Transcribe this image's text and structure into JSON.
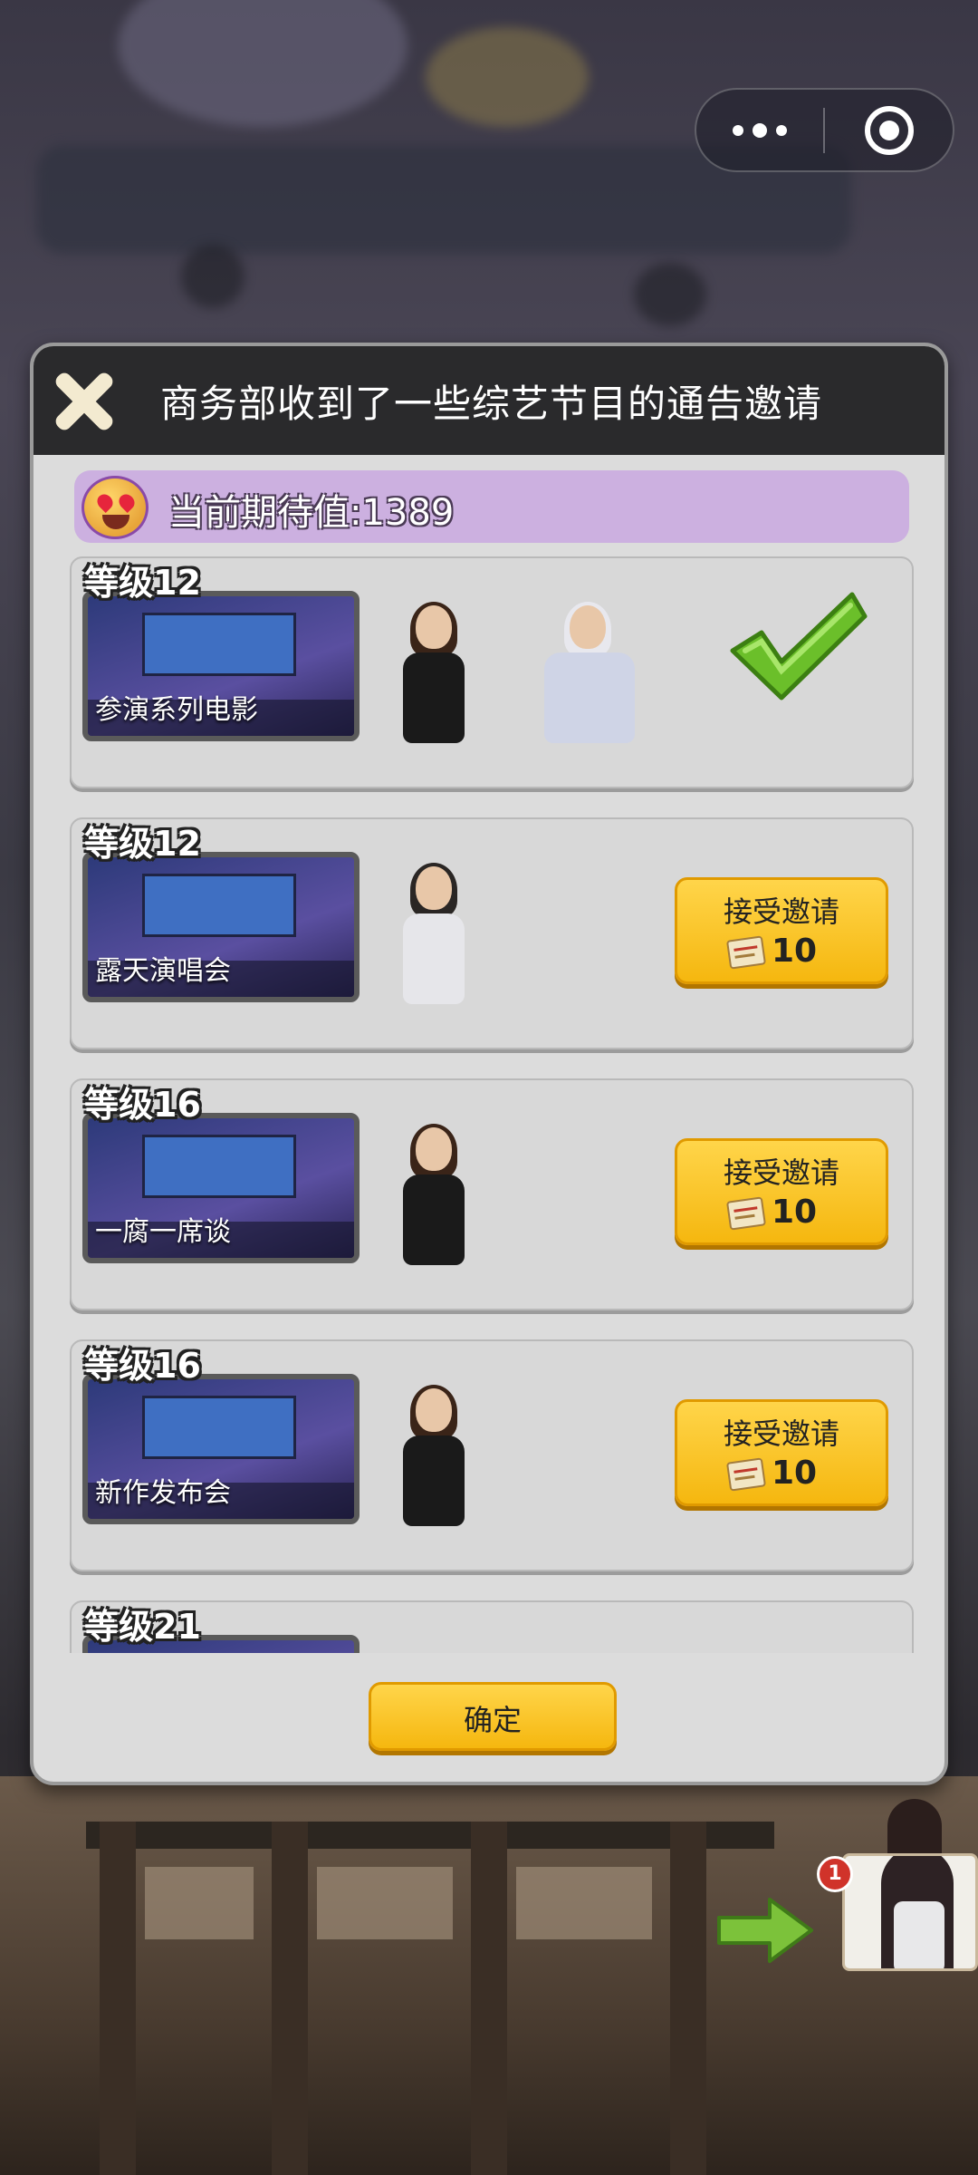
{
  "dialog": {
    "title": "商务部收到了一些综艺节目的通告邀请",
    "expectation_label": "当前期待值:1389"
  },
  "invitations": [
    {
      "level": "等级12",
      "event": "参演系列电影",
      "status": "accepted",
      "characters": [
        "female-black-dress-icon",
        "caped-male-icon"
      ]
    },
    {
      "level": "等级12",
      "event": "露天演唱会",
      "status": "open",
      "button": "接受邀请",
      "cost": "10",
      "characters": [
        "male-white-suit-icon"
      ]
    },
    {
      "level": "等级16",
      "event": "一腐一席谈",
      "status": "open",
      "button": "接受邀请",
      "cost": "10",
      "characters": [
        "female-black-dress-icon"
      ]
    },
    {
      "level": "等级16",
      "event": "新作发布会",
      "status": "open",
      "button": "接受邀请",
      "cost": "10",
      "characters": [
        "female-black-dress-icon"
      ]
    },
    {
      "level": "等级21"
    }
  ],
  "confirm_label": "确定",
  "notification_badge": "1",
  "colors": {
    "header_bg": "#2a2a2c",
    "expect_bar": "#ccb0e0",
    "button_yellow": "#f5b70f",
    "check_green": "#6bbf2a"
  }
}
